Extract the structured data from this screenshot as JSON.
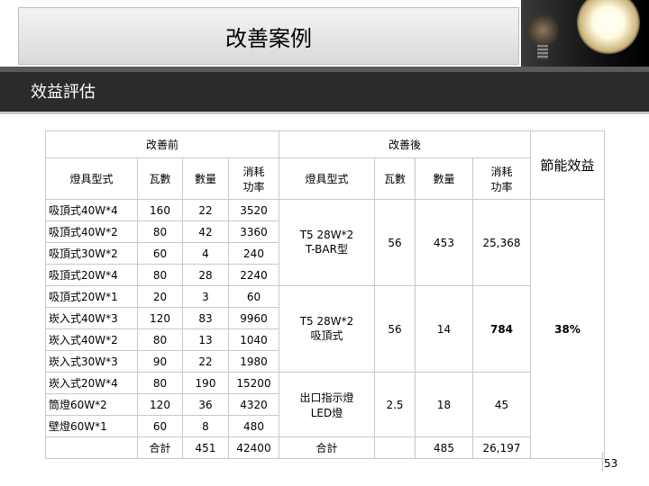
{
  "title": "改善案例",
  "section_title": "效益評估",
  "headers": {
    "before": "改善前",
    "after": "改善後",
    "saving": "節能效益",
    "fixture_type": "燈具型式",
    "watt": "瓦數",
    "qty": "數量",
    "power": "消耗功率"
  },
  "before_rows": [
    {
      "type": "吸頂式40W*4",
      "watt": "160",
      "qty": "22",
      "power": "3520"
    },
    {
      "type": "吸頂式40W*2",
      "watt": "80",
      "qty": "42",
      "power": "3360"
    },
    {
      "type": "吸頂式30W*2",
      "watt": "60",
      "qty": "4",
      "power": "240"
    },
    {
      "type": "吸頂式20W*4",
      "watt": "80",
      "qty": "28",
      "power": "2240"
    },
    {
      "type": "吸頂式20W*1",
      "watt": "20",
      "qty": "3",
      "power": "60"
    },
    {
      "type": "崁入式40W*3",
      "watt": "120",
      "qty": "83",
      "power": "9960"
    },
    {
      "type": "崁入式40W*2",
      "watt": "80",
      "qty": "13",
      "power": "1040"
    },
    {
      "type": "崁入式30W*3",
      "watt": "90",
      "qty": "22",
      "power": "1980"
    },
    {
      "type": "崁入式20W*4",
      "watt": "80",
      "qty": "190",
      "power": "15200"
    },
    {
      "type": "筒燈60W*2",
      "watt": "120",
      "qty": "36",
      "power": "4320"
    },
    {
      "type": "壁燈60W*1",
      "watt": "60",
      "qty": "8",
      "power": "480"
    }
  ],
  "after_groups": [
    {
      "type_line1": "T5 28W*2",
      "type_line2": "T-BAR型",
      "watt": "56",
      "qty": "453",
      "power": "25,368"
    },
    {
      "type_line1": "T5 28W*2",
      "type_line2": "吸頂式",
      "watt": "56",
      "qty": "14",
      "power": "784"
    },
    {
      "type_line1": "出口指示燈",
      "type_line2": "LED燈",
      "watt": "2.5",
      "qty": "18",
      "power": "45"
    }
  ],
  "totals": {
    "label_before": "合計",
    "qty_before": "451",
    "power_before": "42400",
    "label_after": "合計",
    "qty_after": "485",
    "power_after": "26,197"
  },
  "saving_value": "38%",
  "page_number": "53",
  "colors": {
    "saving": "#c00000",
    "dark_bar": "#2b2b2b"
  }
}
